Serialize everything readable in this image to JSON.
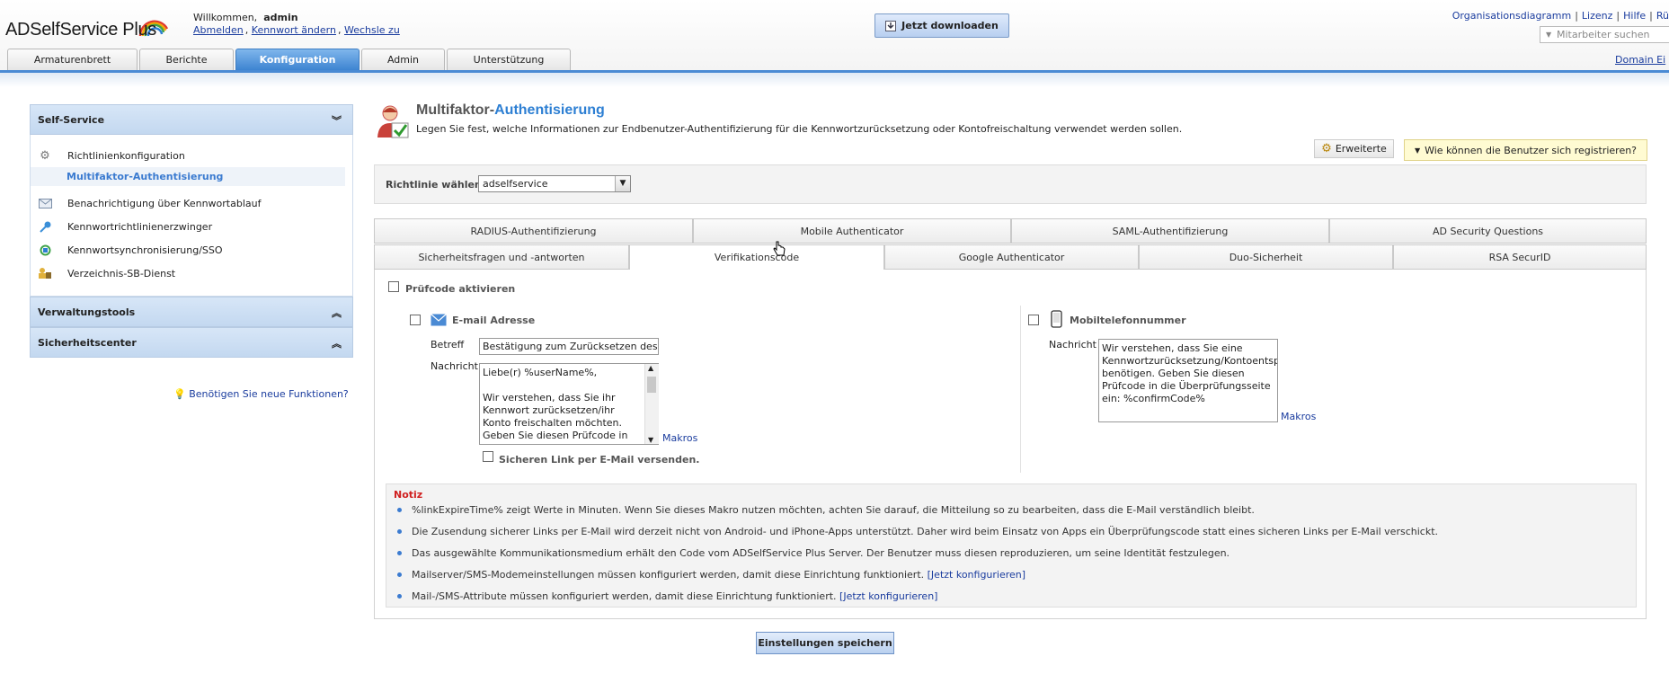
{
  "header": {
    "logo_text": "ADSelfService Plus",
    "welcome_prefix": "Willkommen,",
    "username": "admin",
    "links": [
      "Abmelden",
      "Kennwort ändern",
      "Wechsle zu"
    ],
    "download_label": "Jetzt downloaden",
    "top_links": [
      "Organisationsdiagramm",
      "Lizenz",
      "Hilfe",
      "Rü"
    ],
    "search_placeholder": "Mitarbeiter suchen",
    "domain_link": "Domain Ei"
  },
  "main_tabs": [
    {
      "label": "Armaturenbrett",
      "active": false
    },
    {
      "label": "Berichte",
      "active": false
    },
    {
      "label": "Konfiguration",
      "active": true
    },
    {
      "label": "Admin",
      "active": false
    },
    {
      "label": "Unterstützung",
      "active": false
    }
  ],
  "sidebar": {
    "sections": [
      {
        "title": "Self-Service",
        "expanded": true
      },
      {
        "title": "Verwaltungstools",
        "expanded": false
      },
      {
        "title": "Sicherheitscenter",
        "expanded": false
      }
    ],
    "items": [
      {
        "label": "Richtlinienkonfiguration",
        "icon": "gear-icon"
      },
      {
        "label": "Multifaktor-Authentisierung",
        "selected": true
      },
      {
        "label": "Benachrichtigung über Kennwortablauf",
        "icon": "envelope-icon"
      },
      {
        "label": "Kennwortrichtlinienerzwinger",
        "icon": "key-icon"
      },
      {
        "label": "Kennwortsynchronisierung/SSO",
        "icon": "sync-icon"
      },
      {
        "label": "Verzeichnis-SB-Dienst",
        "icon": "directory-icon"
      }
    ],
    "feature_link": "Benötigen Sie neue Funktionen?"
  },
  "page": {
    "title_part1": "Multifaktor-",
    "title_part2": "Authentisierung",
    "description": "Legen Sie fest, welche Informationen zur Endbenutzer-Authentifizierung für die Kennwortzurücksetzung oder Kontofreischaltung verwendet werden sollen.",
    "advanced_label": "Erweiterte",
    "register_label": "Wie können die Benutzer sich registrieren?",
    "policy_label": "Richtlinie wählen",
    "policy_value": "adselfservice"
  },
  "subtabs_row1": [
    "RADIUS-Authentifizierung",
    "Mobile Authenticator",
    "SAML-Authentifizierung",
    "AD Security Questions"
  ],
  "subtabs_row2": [
    "Sicherheitsfragen und -antworten",
    "Verifikationscode",
    "Google Authenticator",
    "Duo-Sicherheit",
    "RSA SecurID"
  ],
  "active_subtab": "Verifikationscode",
  "form": {
    "enable_label": "Prüfcode aktivieren",
    "email": {
      "title": "E-mail Adresse",
      "subject_label": "Betreff",
      "subject_value": "Bestätigung zum Zurücksetzen des",
      "message_label": "Nachricht",
      "message_value": "Liebe(r) %userName%,\n\nWir verstehen, dass Sie ihr Kennwort zurücksetzen/ihr Konto freischalten möchten. Geben Sie diesen Prüfcode in",
      "macros": "Makros",
      "secure_link_label": "Sicheren Link per E-Mail versenden."
    },
    "mobile": {
      "title": "Mobiltelefonnummer",
      "message_label": "Nachricht",
      "message_value": "Wir verstehen, dass Sie eine Kennwortzurücksetzung/Kontoentsperrung benötigen. Geben Sie diesen Prüfcode in die Überprüfungsseite ein: %confirmCode%",
      "macros": "Makros"
    }
  },
  "notes": {
    "title": "Notiz",
    "items": [
      {
        "text": "%linkExpireTime% zeigt Werte in Minuten. Wenn Sie dieses Makro nutzen möchten, achten Sie darauf, die Mitteilung so zu bearbeiten, dass die E-Mail verständlich bleibt.",
        "link": ""
      },
      {
        "text": "Die Zusendung sicherer Links per E-Mail wird derzeit nicht von Android- und iPhone-Apps unterstützt. Daher wird beim Einsatz von Apps ein Überprüfungscode statt eines sicheren Links per E-Mail verschickt.",
        "link": ""
      },
      {
        "text": "Das ausgewählte Kommunikationsmedium erhält den Code vom ADSelfService Plus Server. Der Benutzer muss diesen reproduzieren, um seine Identität festzulegen.",
        "link": ""
      },
      {
        "text": "Mailserver/SMS-Modemeinstellungen müssen konfiguriert werden, damit diese Einrichtung funktioniert.",
        "link": "[Jetzt konfigurieren]"
      },
      {
        "text": "Mail-/SMS-Attribute müssen konfiguriert werden, damit diese Einrichtung funktioniert.",
        "link": "[Jetzt konfigurieren]"
      }
    ]
  },
  "save_label": "Einstellungen speichern"
}
